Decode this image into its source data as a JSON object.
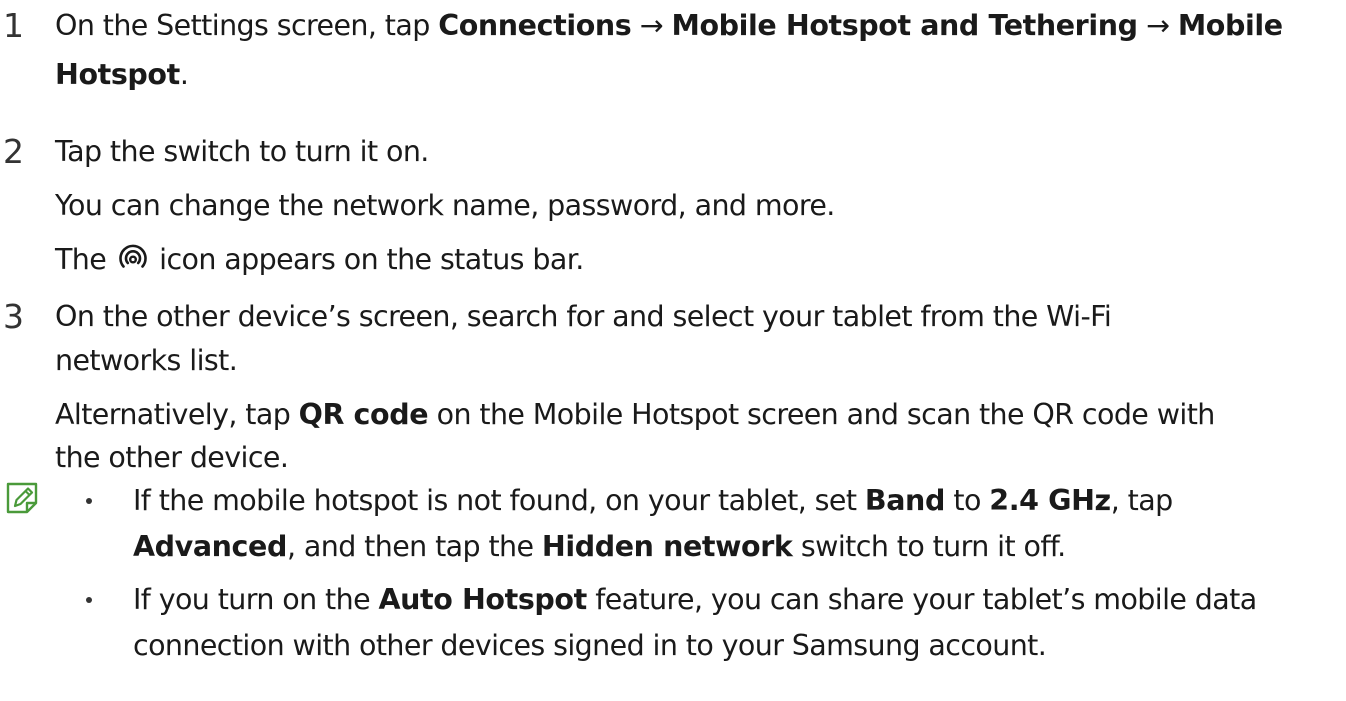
{
  "steps": [
    {
      "number": "1",
      "lines": [
        [
          {
            "t": "On the Settings screen, tap "
          },
          {
            "t": "Connections",
            "b": true
          },
          {
            "t": " → "
          },
          {
            "t": "Mobile Hotspot and Tethering",
            "b": true
          },
          {
            "t": " → "
          },
          {
            "t": "Mobile",
            "b": true
          }
        ],
        [
          {
            "t": "Hotspot",
            "b": true
          },
          {
            "t": "."
          }
        ]
      ]
    },
    {
      "number": "2",
      "lines": [
        [
          {
            "t": "Tap the switch to turn it on."
          }
        ],
        [
          {
            "t": "You can change the network name, password, and more."
          }
        ],
        [
          {
            "t": "The "
          },
          {
            "icon": "hotspot-status-icon"
          },
          {
            "t": " icon appears on the status bar."
          }
        ]
      ]
    },
    {
      "number": "3",
      "lines": [
        [
          {
            "t": "On the other device’s screen, search for and select your tablet from the Wi-Fi"
          }
        ],
        [
          {
            "t": "networks list."
          }
        ],
        [
          {
            "t": "Alternatively, tap "
          },
          {
            "t": "QR code",
            "b": true
          },
          {
            "t": " on the Mobile Hotspot screen and scan the QR code with"
          }
        ],
        [
          {
            "t": "the other device."
          }
        ]
      ]
    }
  ],
  "note": {
    "icon": "note-pencil-icon",
    "bullets": [
      {
        "lines": [
          [
            {
              "t": "If the mobile hotspot is not found, on your tablet, set "
            },
            {
              "t": "Band",
              "b": true
            },
            {
              "t": " to "
            },
            {
              "t": "2.4 GHz",
              "b": true
            },
            {
              "t": ", tap"
            }
          ],
          [
            {
              "t": "Advanced",
              "b": true
            },
            {
              "t": ", and then tap the "
            },
            {
              "t": "Hidden network",
              "b": true
            },
            {
              "t": " switch to turn it off."
            }
          ]
        ]
      },
      {
        "lines": [
          [
            {
              "t": "If you turn on the "
            },
            {
              "t": "Auto Hotspot",
              "b": true
            },
            {
              "t": " feature, you can share your tablet’s mobile data"
            }
          ],
          [
            {
              "t": "connection with other devices signed in to your Samsung account."
            }
          ]
        ]
      }
    ]
  },
  "colors": {
    "text": "#1a1a1a",
    "note_icon": "#4a9a3a"
  }
}
